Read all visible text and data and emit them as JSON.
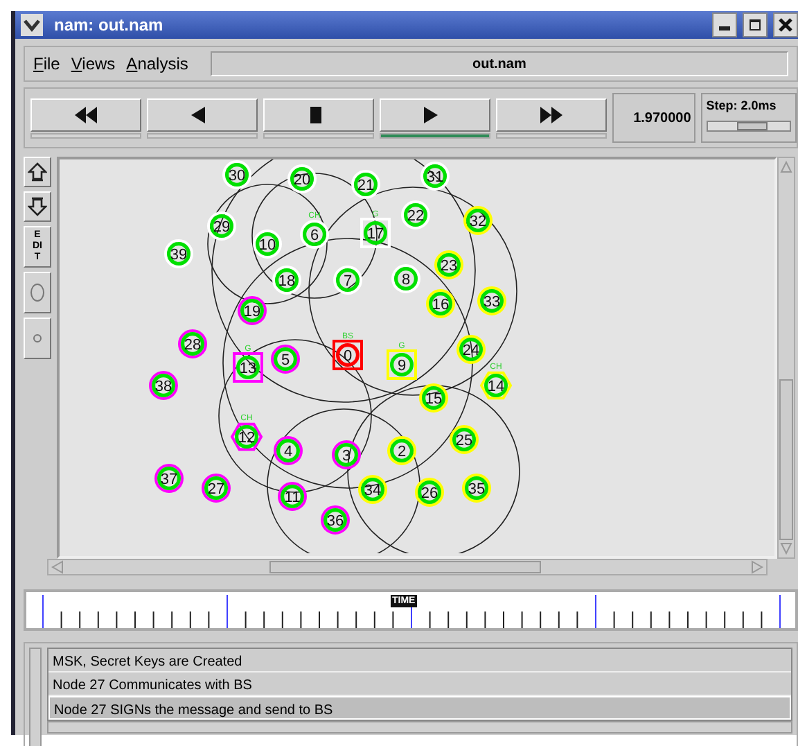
{
  "window": {
    "title": "nam: out.nam"
  },
  "menu": [
    {
      "label": "File"
    },
    {
      "label": "Views"
    },
    {
      "label": "Analysis"
    }
  ],
  "file_name": "out.nam",
  "playback": [
    {
      "kind": "rewind",
      "selected": false
    },
    {
      "kind": "back",
      "selected": false
    },
    {
      "kind": "stop",
      "selected": false
    },
    {
      "kind": "play",
      "selected": true
    },
    {
      "kind": "fast-forward",
      "selected": false
    }
  ],
  "time": "1.970000",
  "step": {
    "label": "Step: 2.0ms",
    "level": 0.55
  },
  "tools": [
    {
      "kind": "zoom-in"
    },
    {
      "kind": "zoom-out"
    },
    {
      "kind": "edit",
      "label": "EDIT"
    },
    {
      "kind": "oval"
    },
    {
      "kind": "dot"
    }
  ],
  "nodes": [
    {
      "label": "30",
      "kind": "circle",
      "color": "#ffffff",
      "highlighted": false
    },
    {
      "label": "20",
      "kind": "circle",
      "color": "#ffffff",
      "highlighted": false
    },
    {
      "label": "21",
      "kind": "circle",
      "color": "#ffffff",
      "highlighted": false
    },
    {
      "label": "31",
      "kind": "circle",
      "color": "#ffffff",
      "highlighted": false
    },
    {
      "label": "29",
      "kind": "circle",
      "color": "#ffffff",
      "highlighted": false
    },
    {
      "label": "39",
      "kind": "circle",
      "color": "#ffffff",
      "highlighted": false
    },
    {
      "label": "10",
      "kind": "circle",
      "color": "#ffffff",
      "highlighted": false
    },
    {
      "label": "6",
      "kind": "circle",
      "color": "#ffffff",
      "highlighted": false,
      "tag": "CH"
    },
    {
      "label": "17",
      "kind": "square",
      "color": "#ffffff",
      "highlighted": false,
      "tag": "G"
    },
    {
      "label": "22",
      "kind": "circle",
      "color": "#ffffff",
      "highlighted": false
    },
    {
      "label": "32",
      "kind": "circle",
      "color": "#ffff00",
      "highlighted": false
    },
    {
      "label": "18",
      "kind": "circle",
      "color": "#ffffff",
      "highlighted": false
    },
    {
      "label": "7",
      "kind": "circle",
      "color": "#ffffff",
      "highlighted": false
    },
    {
      "label": "8",
      "kind": "circle",
      "color": "#ffffff",
      "highlighted": false
    },
    {
      "label": "23",
      "kind": "circle",
      "color": "#ffff00",
      "highlighted": false
    },
    {
      "label": "19",
      "kind": "circle",
      "color": "#ff00ff",
      "highlighted": false
    },
    {
      "label": "16",
      "kind": "circle",
      "color": "#ffff00",
      "highlighted": false
    },
    {
      "label": "33",
      "kind": "circle",
      "color": "#ffff00",
      "highlighted": false
    },
    {
      "label": "28",
      "kind": "circle",
      "color": "#ff00ff",
      "highlighted": false
    },
    {
      "label": "38",
      "kind": "circle",
      "color": "#ff00ff",
      "highlighted": false
    },
    {
      "label": "13",
      "kind": "square",
      "color": "#ff00ff",
      "highlighted": false,
      "tag": "G"
    },
    {
      "label": "5",
      "kind": "circle",
      "color": "#ff00ff",
      "highlighted": false
    },
    {
      "label": "0",
      "kind": "square",
      "color": "#ff0000",
      "highlighted": true,
      "tag": "BS"
    },
    {
      "label": "9",
      "kind": "square",
      "color": "#ffff00",
      "highlighted": false,
      "tag": "G"
    },
    {
      "label": "24",
      "kind": "circle",
      "color": "#ffff00",
      "highlighted": false
    },
    {
      "label": "15",
      "kind": "circle",
      "color": "#ffff00",
      "highlighted": false
    },
    {
      "label": "14",
      "kind": "hexagon",
      "color": "#ffff00",
      "highlighted": false,
      "tag": "CH"
    },
    {
      "label": "12",
      "kind": "hexagon",
      "color": "#ff00ff",
      "highlighted": false,
      "tag": "CH"
    },
    {
      "label": "4",
      "kind": "circle",
      "color": "#ff00ff",
      "highlighted": false
    },
    {
      "label": "3",
      "kind": "circle",
      "color": "#ff00ff",
      "highlighted": false
    },
    {
      "label": "2",
      "kind": "circle",
      "color": "#ffff00",
      "highlighted": false
    },
    {
      "label": "25",
      "kind": "circle",
      "color": "#ffff00",
      "highlighted": false
    },
    {
      "label": "37",
      "kind": "circle",
      "color": "#ff00ff",
      "highlighted": false
    },
    {
      "label": "27",
      "kind": "circle",
      "color": "#ff00ff",
      "highlighted": false
    },
    {
      "label": "11",
      "kind": "circle",
      "color": "#ff00ff",
      "highlighted": false
    },
    {
      "label": "34",
      "kind": "circle",
      "color": "#ffff00",
      "highlighted": false
    },
    {
      "label": "26",
      "kind": "circle",
      "color": "#ffff00",
      "highlighted": false
    },
    {
      "label": "35",
      "kind": "circle",
      "color": "#ffff00",
      "highlighted": false
    },
    {
      "label": "36",
      "kind": "circle",
      "color": "#ff00ff",
      "highlighted": false
    }
  ],
  "timeline": {
    "marker": "TIME"
  },
  "log": [
    {
      "text": "MSK, Secret Keys are Created",
      "selected": false
    },
    {
      "text": "Node 27 Communicates with BS",
      "selected": false
    },
    {
      "text": "Node 27 SIGNs the message and send to BS",
      "selected": true
    }
  ]
}
